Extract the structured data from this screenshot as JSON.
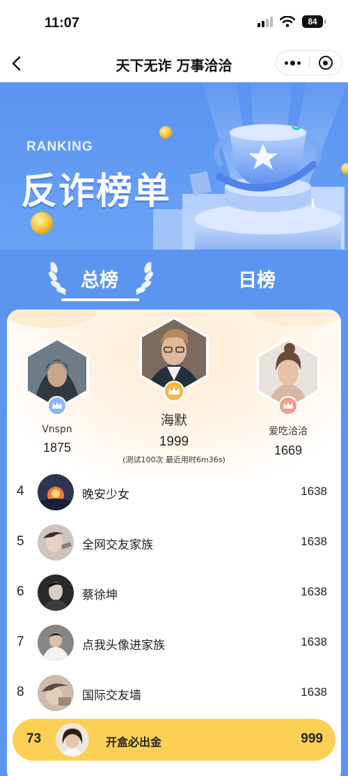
{
  "status_bar": {
    "time": "11:07",
    "battery": "84"
  },
  "nav": {
    "title": "天下无诈 万事洽洽",
    "back_icon": "chevron-left-icon",
    "more_icon": "more-dots-icon",
    "close_icon": "target-circle-icon"
  },
  "hero": {
    "ranking_en": "RANKING",
    "ranking_cn": "反诈榜单"
  },
  "tabs": [
    {
      "label": "总榜",
      "active": true
    },
    {
      "label": "日榜",
      "active": false
    }
  ],
  "podium": {
    "first": {
      "rank": 1,
      "name": "海默",
      "score": "1999",
      "note": "(测试100次 最近用时6m36s)"
    },
    "second": {
      "rank": 2,
      "name": "Vnspn",
      "score": "1875"
    },
    "third": {
      "rank": 3,
      "name": "爱吃洽洽",
      "score": "1669"
    }
  },
  "ranking": [
    {
      "rank": "4",
      "name": "晚安少女",
      "score": "1638"
    },
    {
      "rank": "5",
      "name": "全网交友家族",
      "score": "1638"
    },
    {
      "rank": "6",
      "name": "蔡徐坤",
      "score": "1638"
    },
    {
      "rank": "7",
      "name": "点我头像进家族",
      "score": "1638"
    },
    {
      "rank": "8",
      "name": "国际交友墙",
      "score": "1638"
    }
  ],
  "my_rank": {
    "rank": "73",
    "name": "开盒必出金",
    "score": "999"
  },
  "colors": {
    "primary_blue": "#5b95f0",
    "gold": "#fcd055",
    "crown_gold": "#f4b740",
    "crown_silver": "#8fb6f2",
    "crown_bronze": "#f0a08c"
  }
}
